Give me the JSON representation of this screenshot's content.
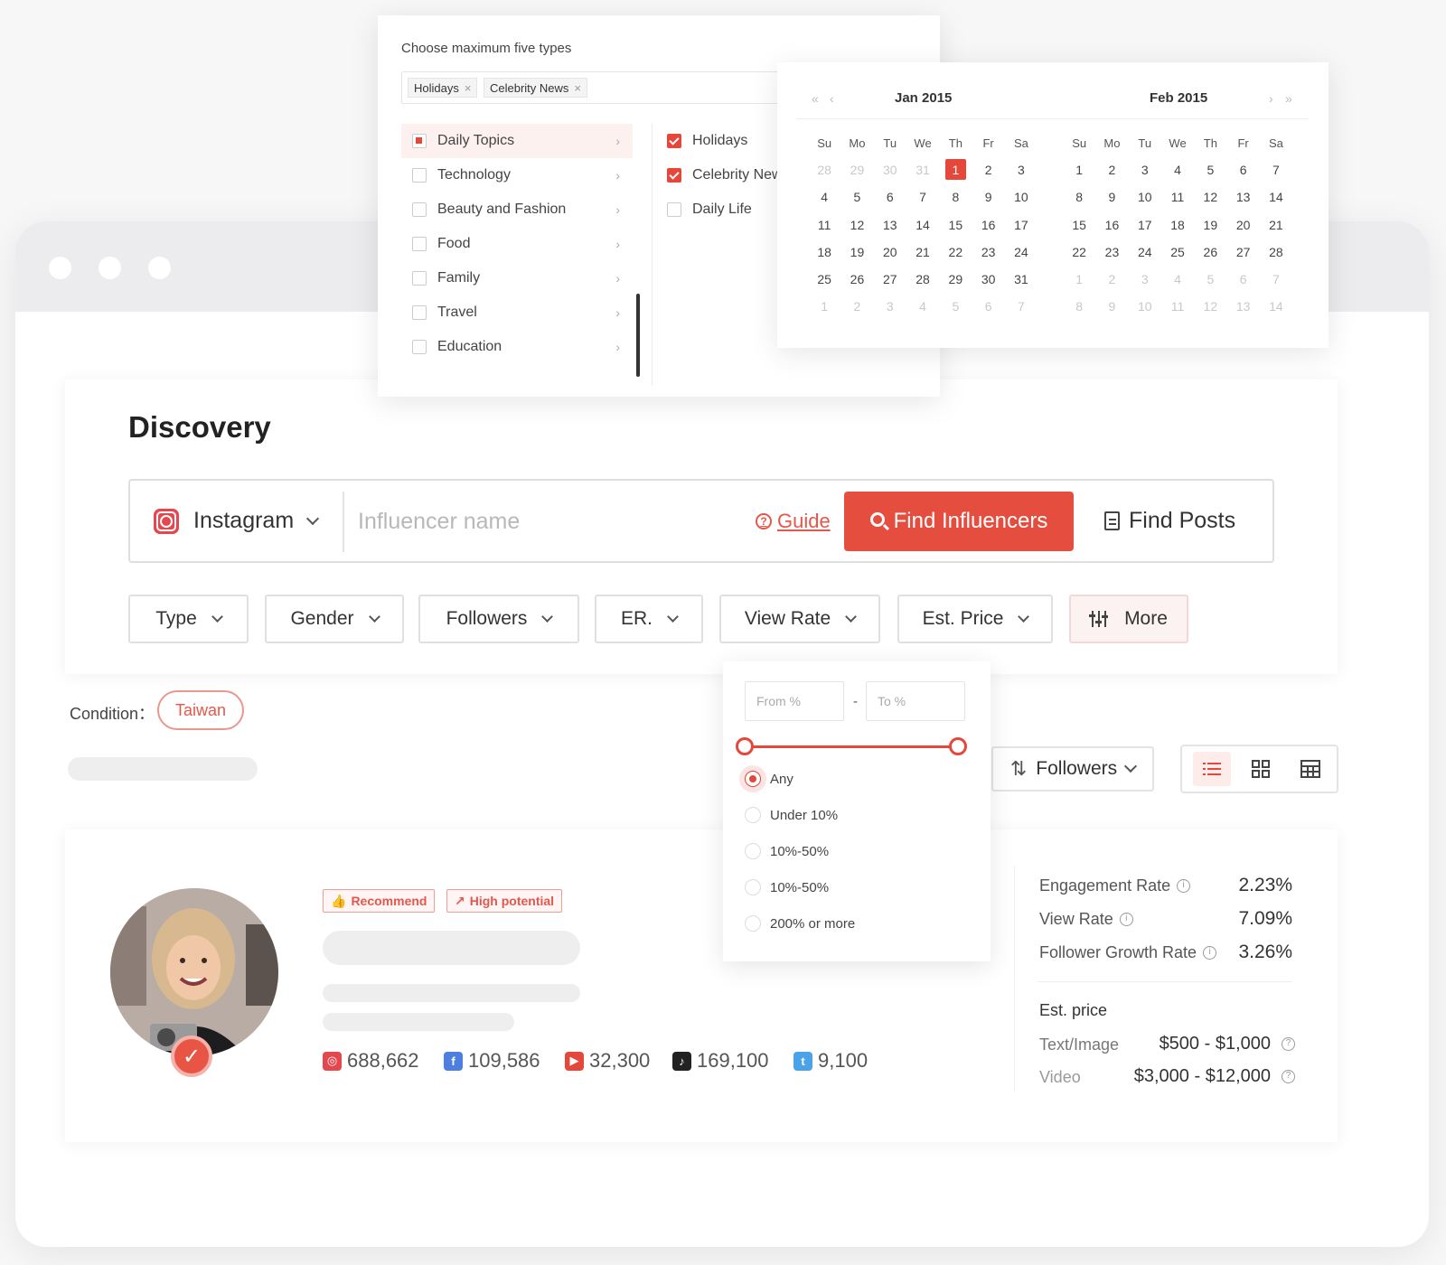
{
  "window": {
    "controls": [
      "close",
      "minimize",
      "maximize"
    ]
  },
  "discovery": {
    "title": "Discovery",
    "platform": "Instagram",
    "search_placeholder": "Influencer name",
    "guide_label": "Guide",
    "find_influencers_label": "Find Influencers",
    "find_posts_label": "Find Posts",
    "filters": [
      "Type",
      "Gender",
      "Followers",
      "ER.",
      "View Rate",
      "Est. Price"
    ],
    "more_label": "More"
  },
  "condition": {
    "label": "Condition：",
    "chips": [
      "Taiwan"
    ]
  },
  "sort": {
    "label": "Followers"
  },
  "view_modes": {
    "options": [
      "list",
      "grid",
      "table"
    ],
    "selected": "list"
  },
  "topics_popup": {
    "title": "Choose maximum five types",
    "selected_chips": [
      "Holidays",
      "Celebrity News"
    ],
    "categories": [
      {
        "label": "Daily Topics",
        "state": "partial"
      },
      {
        "label": "Technology",
        "state": "unchecked"
      },
      {
        "label": "Beauty and Fashion",
        "state": "unchecked"
      },
      {
        "label": "Food",
        "state": "unchecked"
      },
      {
        "label": "Family",
        "state": "unchecked"
      },
      {
        "label": "Travel",
        "state": "unchecked"
      },
      {
        "label": "Education",
        "state": "unchecked"
      }
    ],
    "subcategories": [
      {
        "label": "Holidays",
        "checked": true
      },
      {
        "label": "Celebrity News",
        "checked": true
      },
      {
        "label": "Daily Life",
        "checked": false
      }
    ]
  },
  "calendar": {
    "weekdays": [
      "Su",
      "Mo",
      "Tu",
      "We",
      "Th",
      "Fr",
      "Sa"
    ],
    "months": [
      {
        "title": "Jan  2015",
        "days": [
          "28",
          "29",
          "30",
          "31",
          "1",
          "2",
          "3",
          "4",
          "5",
          "6",
          "7",
          "8",
          "9",
          "10",
          "11",
          "12",
          "13",
          "14",
          "15",
          "16",
          "17",
          "18",
          "19",
          "20",
          "21",
          "22",
          "23",
          "24",
          "25",
          "26",
          "27",
          "28",
          "29",
          "30",
          "31",
          "1",
          "2",
          "3",
          "4",
          "5",
          "6",
          "7"
        ],
        "muted": [
          0,
          1,
          2,
          3,
          35,
          36,
          37,
          38,
          39,
          40,
          41
        ],
        "selected": 4
      },
      {
        "title": "Feb  2015",
        "days": [
          "1",
          "2",
          "3",
          "4",
          "5",
          "6",
          "7",
          "8",
          "9",
          "10",
          "11",
          "12",
          "13",
          "14",
          "15",
          "16",
          "17",
          "18",
          "19",
          "20",
          "21",
          "22",
          "23",
          "24",
          "25",
          "26",
          "27",
          "28",
          "1",
          "2",
          "3",
          "4",
          "5",
          "6",
          "7",
          "8",
          "9",
          "10",
          "11",
          "12",
          "13",
          "14"
        ],
        "muted": [
          28,
          29,
          30,
          31,
          32,
          33,
          34,
          35,
          36,
          37,
          38,
          39,
          40,
          41
        ],
        "selected": -1
      }
    ]
  },
  "range_popup": {
    "from_placeholder": "From %",
    "to_placeholder": "To %",
    "dash": "-",
    "slider_from": 0,
    "slider_to": 1,
    "options": [
      "Any",
      "Under 10%",
      "10%-50%",
      "10%-50%",
      "200% or more"
    ],
    "selected": "Any"
  },
  "influencer": {
    "tags": [
      "Recommend",
      "High potential"
    ],
    "social": [
      {
        "platform": "instagram",
        "icon": "instagram-icon",
        "count": "688,662",
        "color": "#e5474f"
      },
      {
        "platform": "facebook",
        "icon": "facebook-icon",
        "count": "109,586",
        "color": "#4c7fe0"
      },
      {
        "platform": "youtube",
        "icon": "youtube-icon",
        "count": "32,300",
        "color": "#e5473b"
      },
      {
        "platform": "tiktok",
        "icon": "tiktok-icon",
        "count": "169,100",
        "color": "#222222"
      },
      {
        "platform": "twitter",
        "icon": "twitter-icon",
        "count": "9,100",
        "color": "#4aa3e8"
      }
    ],
    "metrics": [
      {
        "label": "Engagement Rate",
        "value": "2.23%"
      },
      {
        "label": "View Rate",
        "value": "7.09%"
      },
      {
        "label": "Follower Growth Rate",
        "value": "3.26%"
      }
    ],
    "price_title": "Est. price",
    "prices": [
      {
        "label": "Text/Image",
        "value": "$500 - $1,000"
      },
      {
        "label": "Video",
        "value": "$3,000 - $12,000"
      }
    ]
  },
  "colors": {
    "accent": "#e54d3f",
    "accent_light": "#fdecea"
  }
}
